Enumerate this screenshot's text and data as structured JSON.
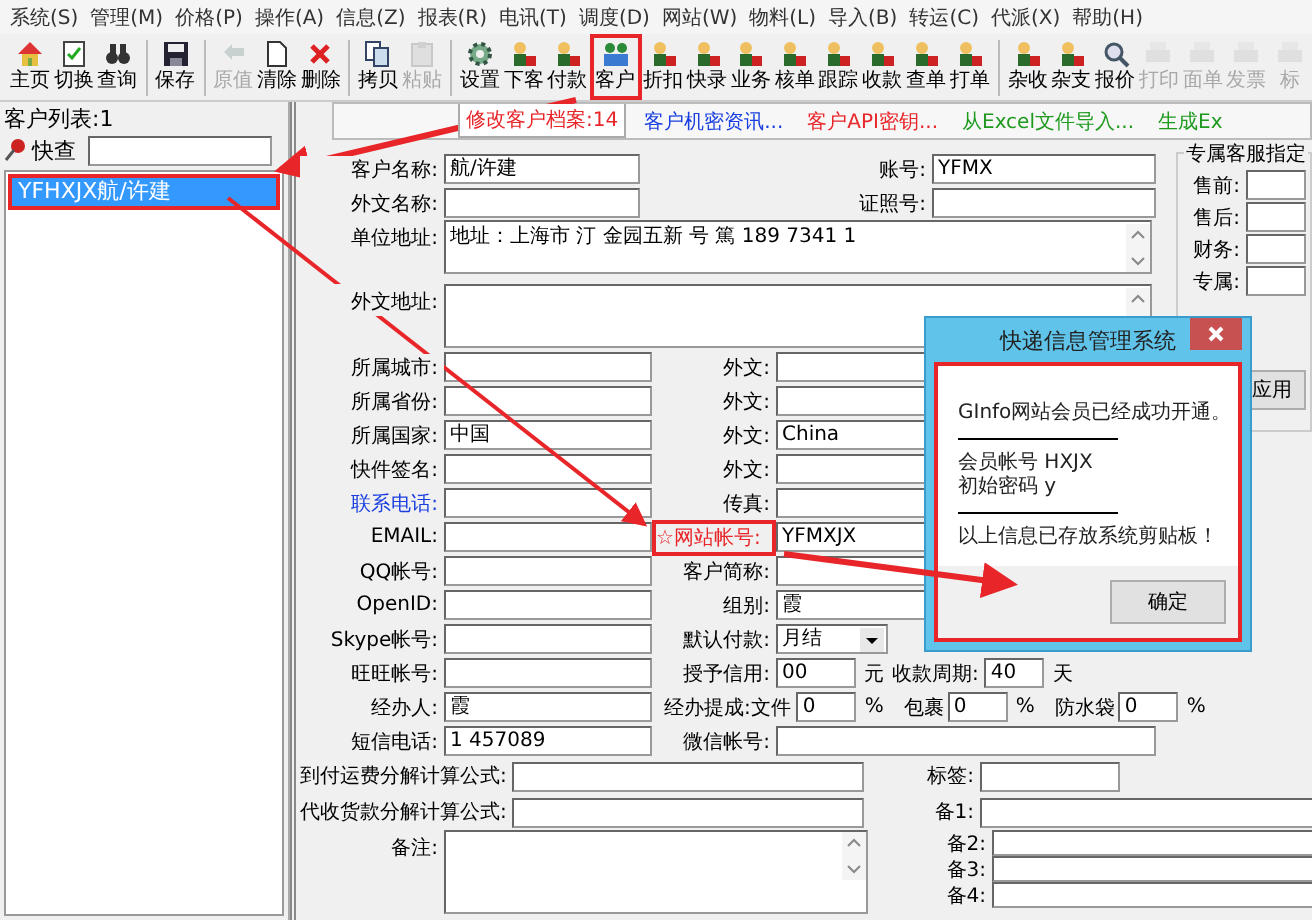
{
  "menu": [
    "系统(S)",
    "管理(M)",
    "价格(P)",
    "操作(A)",
    "信息(Z)",
    "报表(R)",
    "电讯(T)",
    "调度(D)",
    "网站(W)",
    "物料(L)",
    "导入(B)",
    "转运(C)",
    "代派(X)",
    "帮助(H)"
  ],
  "toolbar": [
    [
      {
        "label": "主页",
        "disabled": false,
        "highlighted": false
      },
      {
        "label": "切换",
        "disabled": false,
        "highlighted": false
      },
      {
        "label": "查询",
        "disabled": false,
        "highlighted": false
      }
    ],
    [
      {
        "label": "保存",
        "disabled": false,
        "highlighted": false
      }
    ],
    [
      {
        "label": "原值",
        "disabled": true,
        "highlighted": false
      },
      {
        "label": "清除",
        "disabled": false,
        "highlighted": false
      },
      {
        "label": "删除",
        "disabled": false,
        "highlighted": false
      }
    ],
    [
      {
        "label": "拷贝",
        "disabled": false,
        "highlighted": false
      },
      {
        "label": "粘贴",
        "disabled": true,
        "highlighted": false
      }
    ],
    [
      {
        "label": "设置",
        "disabled": false,
        "highlighted": false
      },
      {
        "label": "下客",
        "disabled": false,
        "highlighted": false
      },
      {
        "label": "付款",
        "disabled": false,
        "highlighted": false
      },
      {
        "label": "客户",
        "disabled": false,
        "highlighted": true
      },
      {
        "label": "折扣",
        "disabled": false,
        "highlighted": false
      },
      {
        "label": "快录",
        "disabled": false,
        "highlighted": false
      },
      {
        "label": "业务",
        "disabled": false,
        "highlighted": false
      },
      {
        "label": "核单",
        "disabled": false,
        "highlighted": false
      },
      {
        "label": "跟踪",
        "disabled": false,
        "highlighted": false
      },
      {
        "label": "收款",
        "disabled": false,
        "highlighted": false
      },
      {
        "label": "查单",
        "disabled": false,
        "highlighted": false
      },
      {
        "label": "打单",
        "disabled": false,
        "highlighted": false
      }
    ],
    [
      {
        "label": "杂收",
        "disabled": false,
        "highlighted": false
      },
      {
        "label": "杂支",
        "disabled": false,
        "highlighted": false
      },
      {
        "label": "报价",
        "disabled": false,
        "highlighted": false
      },
      {
        "label": "打印",
        "disabled": true,
        "highlighted": false
      },
      {
        "label": "面单",
        "disabled": true,
        "highlighted": false
      },
      {
        "label": "发票",
        "disabled": true,
        "highlighted": false
      },
      {
        "label": "标",
        "disabled": true,
        "highlighted": false
      }
    ]
  ],
  "sidebar": {
    "title": "客户列表:1",
    "search_label": "快查",
    "items": [
      {
        "label": "YFHXJX航/许建",
        "selected": true,
        "highlighted": true
      }
    ]
  },
  "links": [
    {
      "label": "修改客户档案:14",
      "color": "#e8262a",
      "selected": true
    },
    {
      "label": "客户机密资讯...",
      "color": "#1a3fe0",
      "selected": false
    },
    {
      "label": "客户API密钥...",
      "color": "#e8262a",
      "selected": false
    },
    {
      "label": "从Excel文件导入...",
      "color": "#1e9a1e",
      "selected": false
    },
    {
      "label": "生成Ex",
      "color": "#1e9a1e",
      "selected": false
    }
  ],
  "form": [
    {
      "kind": "account",
      "label": "客户名称:",
      "value": "航/许建",
      "label2": "账号:",
      "value2": "YFMX"
    },
    {
      "kind": "account",
      "label": "外文名称:",
      "label2": "证照号:"
    },
    {
      "kind": "address",
      "label": "单位地址:",
      "value": "地址：上海市 汀 金园五新 号 篤 189 7341 1"
    },
    {
      "kind": "memo",
      "label": "外文地址:"
    },
    {
      "kind": "pair",
      "label": "所属城市:",
      "link": false,
      "label2": "外文:",
      "required": false
    },
    {
      "kind": "pair",
      "label": "所属省份:",
      "link": false,
      "label2": "外文:",
      "required": false
    },
    {
      "kind": "pair",
      "label": "所属国家:",
      "link": false,
      "value": "中国",
      "label2": "外文:",
      "required": false,
      "value2": "China"
    },
    {
      "kind": "pair",
      "label": "快件签名:",
      "link": false,
      "label2": "外文:",
      "required": false
    },
    {
      "kind": "pair",
      "label": "联系电话:",
      "link": true,
      "label2": "传真:",
      "required": false
    },
    {
      "kind": "pair",
      "label": "EMAIL:",
      "link": false,
      "label2": "☆网站帐号:",
      "required": true,
      "label2_highlighted": true,
      "value2": "YFMXJX"
    },
    {
      "kind": "pair",
      "label": "QQ帐号:",
      "link": false,
      "label2": "客户简称:",
      "required": false
    },
    {
      "kind": "pair",
      "label": "OpenID:",
      "link": false,
      "label2": "组别:",
      "required": false,
      "value2": "霞"
    },
    {
      "kind": "select",
      "label": "Skype帐号:",
      "link": false,
      "label2": "默认付款:",
      "required": false,
      "value2": "月结"
    },
    {
      "kind": "credit",
      "label": "旺旺帐号:",
      "label2": "授予信用:",
      "value2": "00",
      "unit": "元",
      "label3": "收款周期:",
      "value3": "40",
      "unit3": "天"
    },
    {
      "kind": "commission",
      "label": "经办人:",
      "value": "霞",
      "label2": "经办提成:文件",
      "value2": "0",
      "unit": "%",
      "extras": [
        {
          "label": "包裹",
          "value": "0",
          "unit": "%"
        },
        {
          "label": "防水袋",
          "value": "0",
          "unit": "%"
        }
      ]
    },
    {
      "kind": "pair",
      "label": "短信电话:",
      "link": false,
      "value": "1 457089",
      "label2": "微信帐号:",
      "required": false
    },
    {
      "kind": "formula",
      "label": "到付运费分解计算公式:",
      "side_label": "标签:"
    },
    {
      "kind": "formula",
      "label": "代收货款分解计算公式:",
      "side_label": "备1:"
    },
    {
      "kind": "remark",
      "label": "备注:",
      "side_labels": [
        "备2:",
        "备3:",
        "备4:"
      ]
    }
  ],
  "service_group": {
    "title": "专属客服指定",
    "fields": [
      "售前:",
      "售后:",
      "财务:",
      "专属:"
    ],
    "button": "应用"
  },
  "dialog": {
    "title": "快递信息管理系统",
    "highlighted": true,
    "lines": [
      {
        "kind": "text",
        "text": "GInfo网站会员已经成功开通。"
      },
      {
        "kind": "rule"
      },
      {
        "kind": "text",
        "text": "会员帐号 HXJX"
      },
      {
        "kind": "text",
        "text": "初始密码 y"
      },
      {
        "kind": "rule"
      },
      {
        "kind": "text",
        "text": "以上信息已存放系统剪贴板！"
      }
    ],
    "button": "确定"
  }
}
